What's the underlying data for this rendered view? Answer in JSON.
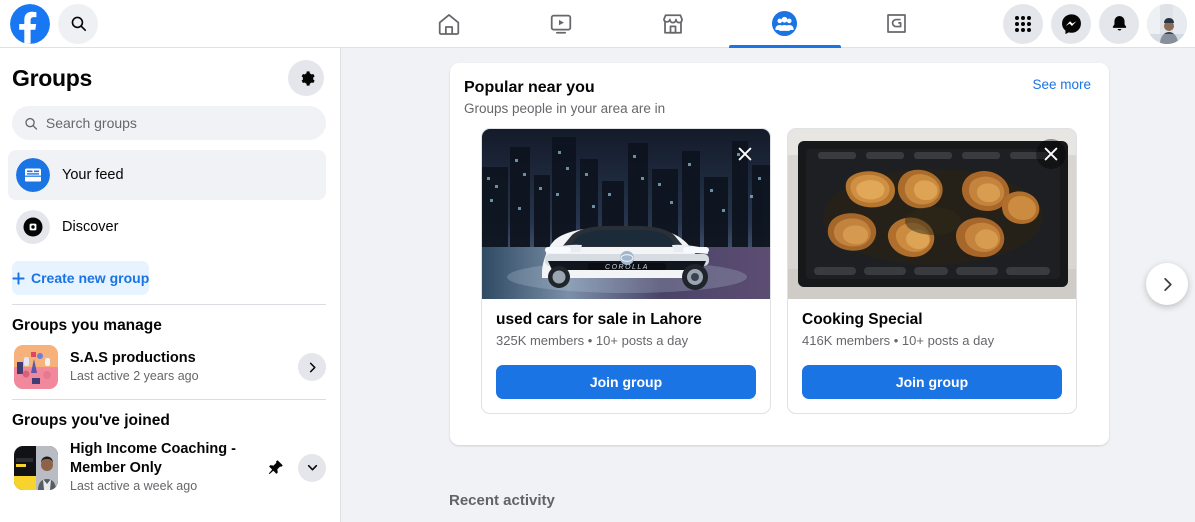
{
  "topbar": {
    "logo_icon": "facebook-logo-icon",
    "search_icon": "search-icon",
    "tabs": [
      {
        "name": "home",
        "icon": "home-icon",
        "active": false
      },
      {
        "name": "video",
        "icon": "video-play-icon",
        "active": false
      },
      {
        "name": "marketplace",
        "icon": "marketplace-storefront-icon",
        "active": false
      },
      {
        "name": "groups",
        "icon": "groups-people-icon",
        "active": true
      },
      {
        "name": "gaming",
        "icon": "gaming-icon",
        "active": false
      }
    ],
    "actions": [
      {
        "name": "menu-grid",
        "icon": "grid-menu-icon"
      },
      {
        "name": "messenger",
        "icon": "messenger-icon"
      },
      {
        "name": "notifications",
        "icon": "bell-icon"
      },
      {
        "name": "account",
        "icon": "avatar"
      }
    ]
  },
  "sidebar": {
    "title": "Groups",
    "settings_icon": "gear-icon",
    "search": {
      "placeholder": "Search groups",
      "value": "",
      "icon": "search-icon"
    },
    "nav": [
      {
        "label": "Your feed",
        "icon": "feed-icon",
        "active": true
      },
      {
        "label": "Discover",
        "icon": "discover-compass-icon",
        "active": false
      }
    ],
    "create_button": {
      "label": "Create new group",
      "icon": "plus-icon"
    },
    "manage_section": {
      "title": "Groups you manage",
      "groups": [
        {
          "name": "S.A.S productions",
          "subtitle": "Last active 2 years ago",
          "thumb": "illustration-pink-orange",
          "action_icon": "chevron-right-icon"
        }
      ]
    },
    "joined_section": {
      "title": "Groups you've joined",
      "groups": [
        {
          "name": "High Income Coaching - Member Only",
          "subtitle": "Last active a week ago",
          "thumb": "coaching-man-yellow-banner",
          "pinned": true,
          "pin_icon": "pin-icon",
          "action_icon": "chevron-down-icon"
        }
      ]
    }
  },
  "main": {
    "popular_card": {
      "title": "Popular near you",
      "subtitle": "Groups people in your area are in",
      "see_more": "See more",
      "next_icon": "chevron-right-icon",
      "close_icon": "close-x-icon",
      "groups": [
        {
          "name": "used cars for sale in Lahore",
          "meta": "325K members • 10+ posts a day",
          "join_label": "Join group",
          "image": "white-toyota-corolla-night-city"
        },
        {
          "name": "Cooking Special",
          "meta": "416K members • 10+ posts a day",
          "join_label": "Join group",
          "image": "roasted-chicken-baking-tray"
        }
      ]
    },
    "recent_activity_title": "Recent activity"
  },
  "colors": {
    "brand_blue": "#1b74e4",
    "page_bg": "#f0f2f5",
    "card_bg": "#ffffff",
    "text_secondary": "#65676b"
  }
}
